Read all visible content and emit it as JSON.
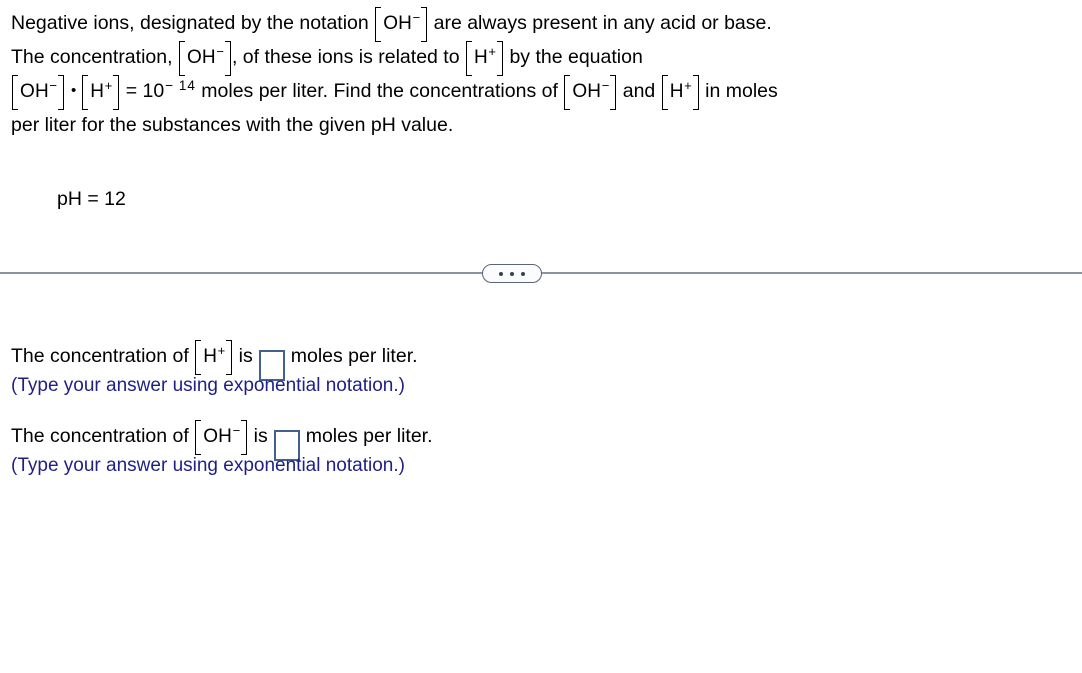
{
  "problem": {
    "line1": {
      "pre": "Negative ions, designated by the notation",
      "ion": {
        "symbol": "OH",
        "charge": "−"
      },
      "post": "are always present in any acid or base."
    },
    "line2": {
      "pre": "The concentration,",
      "ion1": {
        "symbol": "OH",
        "charge": "−"
      },
      "mid": ", of these ions is related to",
      "ion2": {
        "symbol": "H",
        "charge": "+"
      },
      "post": "by the equation"
    },
    "line3": {
      "ion1": {
        "symbol": "OH",
        "charge": "−"
      },
      "operator": "•",
      "ion2": {
        "symbol": "H",
        "charge": "+"
      },
      "equals": "= 10",
      "exponent": "− 14",
      "mid": "moles per liter. Find the concentrations of",
      "ion3": {
        "symbol": "OH",
        "charge": "−"
      },
      "and": "and",
      "ion4": {
        "symbol": "H",
        "charge": "+"
      },
      "post": "in moles"
    },
    "line4": "per liter for the substances with the given pH value.",
    "given": "pH = 12"
  },
  "divider": {
    "more_options_label": "more-options",
    "dot_count": 3,
    "line_color": "#8b93a1"
  },
  "answers": [
    {
      "prefix": "The concentration of",
      "ion": {
        "symbol": "H",
        "charge": "+"
      },
      "verb": "is",
      "input_value": "",
      "input_placeholder": "",
      "suffix": "moles per liter.",
      "hint": "(Type your answer using exponential notation.)"
    },
    {
      "prefix": "The concentration of",
      "ion": {
        "symbol": "OH",
        "charge": "−"
      },
      "verb": "is",
      "input_value": "",
      "input_placeholder": "",
      "suffix": "moles per liter.",
      "hint": "(Type your answer using exponential notation.)"
    }
  ],
  "colors": {
    "hint_blue": "#1f1f87",
    "input_border_blue": "#41618f",
    "divider_gray": "#8b93a1"
  }
}
